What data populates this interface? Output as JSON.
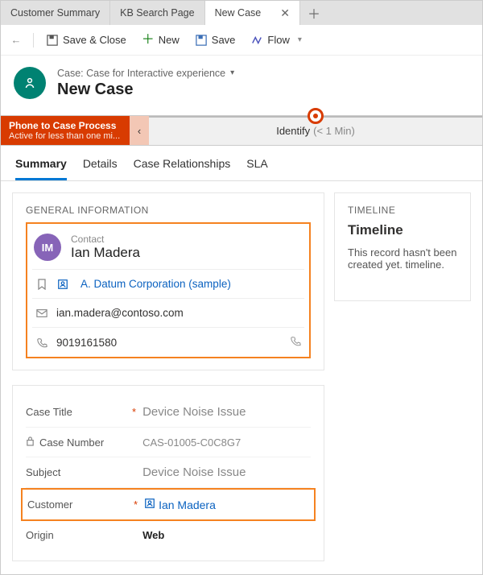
{
  "tabs": {
    "t0": "Customer Summary",
    "t1": "KB Search Page",
    "t2": "New Case"
  },
  "commands": {
    "save_close": "Save & Close",
    "new": "New",
    "save": "Save",
    "flow": "Flow"
  },
  "header": {
    "breadcrumb": "Case: Case for Interactive experience",
    "title": "New Case"
  },
  "process": {
    "name": "Phone to Case Process",
    "status": "Active for less than one mi...",
    "stage": "Identify",
    "duration": "(< 1 Min)"
  },
  "sectiontabs": {
    "summary": "Summary",
    "details": "Details",
    "rel": "Case Relationships",
    "sla": "SLA"
  },
  "general": {
    "title": "GENERAL INFORMATION",
    "contact_label": "Contact",
    "contact_initials": "IM",
    "contact_name": "Ian Madera",
    "account": "A. Datum Corporation (sample)",
    "email": "ian.madera@contoso.com",
    "phone": "9019161580"
  },
  "form": {
    "case_title_label": "Case Title",
    "case_title_value": "Device Noise Issue",
    "case_number_label": "Case Number",
    "case_number_value": "CAS-01005-C0C8G7",
    "subject_label": "Subject",
    "subject_value": "Device Noise Issue",
    "customer_label": "Customer",
    "customer_value": "Ian Madera",
    "origin_label": "Origin",
    "origin_value": "Web"
  },
  "timeline": {
    "section": "TIMELINE",
    "heading": "Timeline",
    "empty": "This record hasn't been created yet. timeline."
  }
}
